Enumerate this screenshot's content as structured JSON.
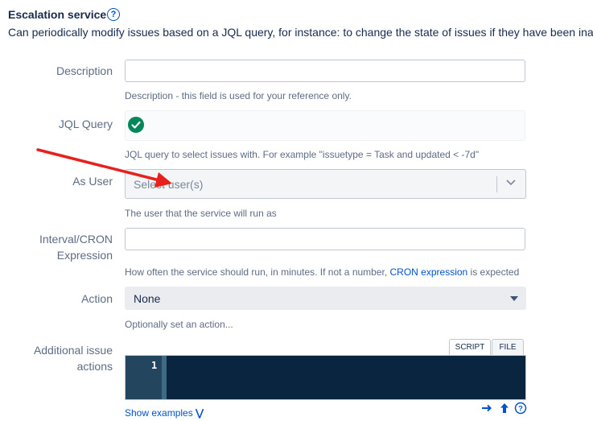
{
  "header": {
    "title": "Escalation service",
    "subtitle": "Can periodically modify issues based on a JQL query, for instance: to change the state of issues if they have been inact"
  },
  "fields": {
    "description": {
      "label": "Description",
      "value": "",
      "hint": "Description - this field is used for your reference only."
    },
    "jql": {
      "label": "JQL Query",
      "value": "",
      "hint": "JQL query to select issues with. For example \"issuetype = Task and updated < -7d\""
    },
    "as_user": {
      "label": "As User",
      "placeholder": "Select user(s)",
      "hint": "The user that the service will run as"
    },
    "interval": {
      "label_line1": "Interval/CRON",
      "label_line2": "Expression",
      "value": "",
      "hint_before": "How often the service should run, in minutes. If not a number, ",
      "hint_link": "CRON expression",
      "hint_after": " is expected"
    },
    "action": {
      "label": "Action",
      "selected": "None",
      "hint": "Optionally set an action..."
    },
    "additional": {
      "label_line1": "Additional issue",
      "label_line2": "actions",
      "tabs": [
        "SCRIPT",
        "FILE"
      ],
      "line_number": "1",
      "show_examples": "Show examples"
    }
  },
  "colors": {
    "accent": "#0052cc",
    "success": "#00875a",
    "editor_bg": "#0a2540",
    "annotation_arrow": "#e8201c"
  }
}
